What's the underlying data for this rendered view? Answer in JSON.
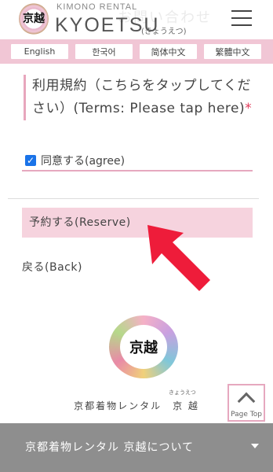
{
  "header": {
    "brand_small": "KIMONO RENTAL",
    "brand_big": "KYOETSU",
    "brand_ruby": "(きょうえつ)",
    "logo_kanji": "京越",
    "faint_overlay": "お問い合わせ"
  },
  "languages": [
    "English",
    "한국어",
    "简体中文",
    "繁體中文"
  ],
  "form": {
    "terms_text": "利用規約（こちらをタップしてください）(Terms: Please tap here)",
    "required_mark": "*",
    "agree_label": "同意する(agree)",
    "agree_checked": true,
    "reserve_label": "予約する(Reserve)",
    "back_label": "戻る(Back)"
  },
  "footer": {
    "logo_kanji": "京越",
    "company_name": "京都着物レンタル　京 越",
    "company_ruby": "きょうえつ",
    "page_top": "Page Top",
    "bottom_menu": "京都着物レンタル 京越について"
  },
  "colors": {
    "pink_bar": "#f1c6d5",
    "reserve_bg": "#f6d3de",
    "accent_border": "#e8a6bd",
    "required": "#e23b5a",
    "checkbox": "#1a73e8",
    "arrow": "#ee1c3a",
    "bottom_bar": "#8e8e8e"
  }
}
